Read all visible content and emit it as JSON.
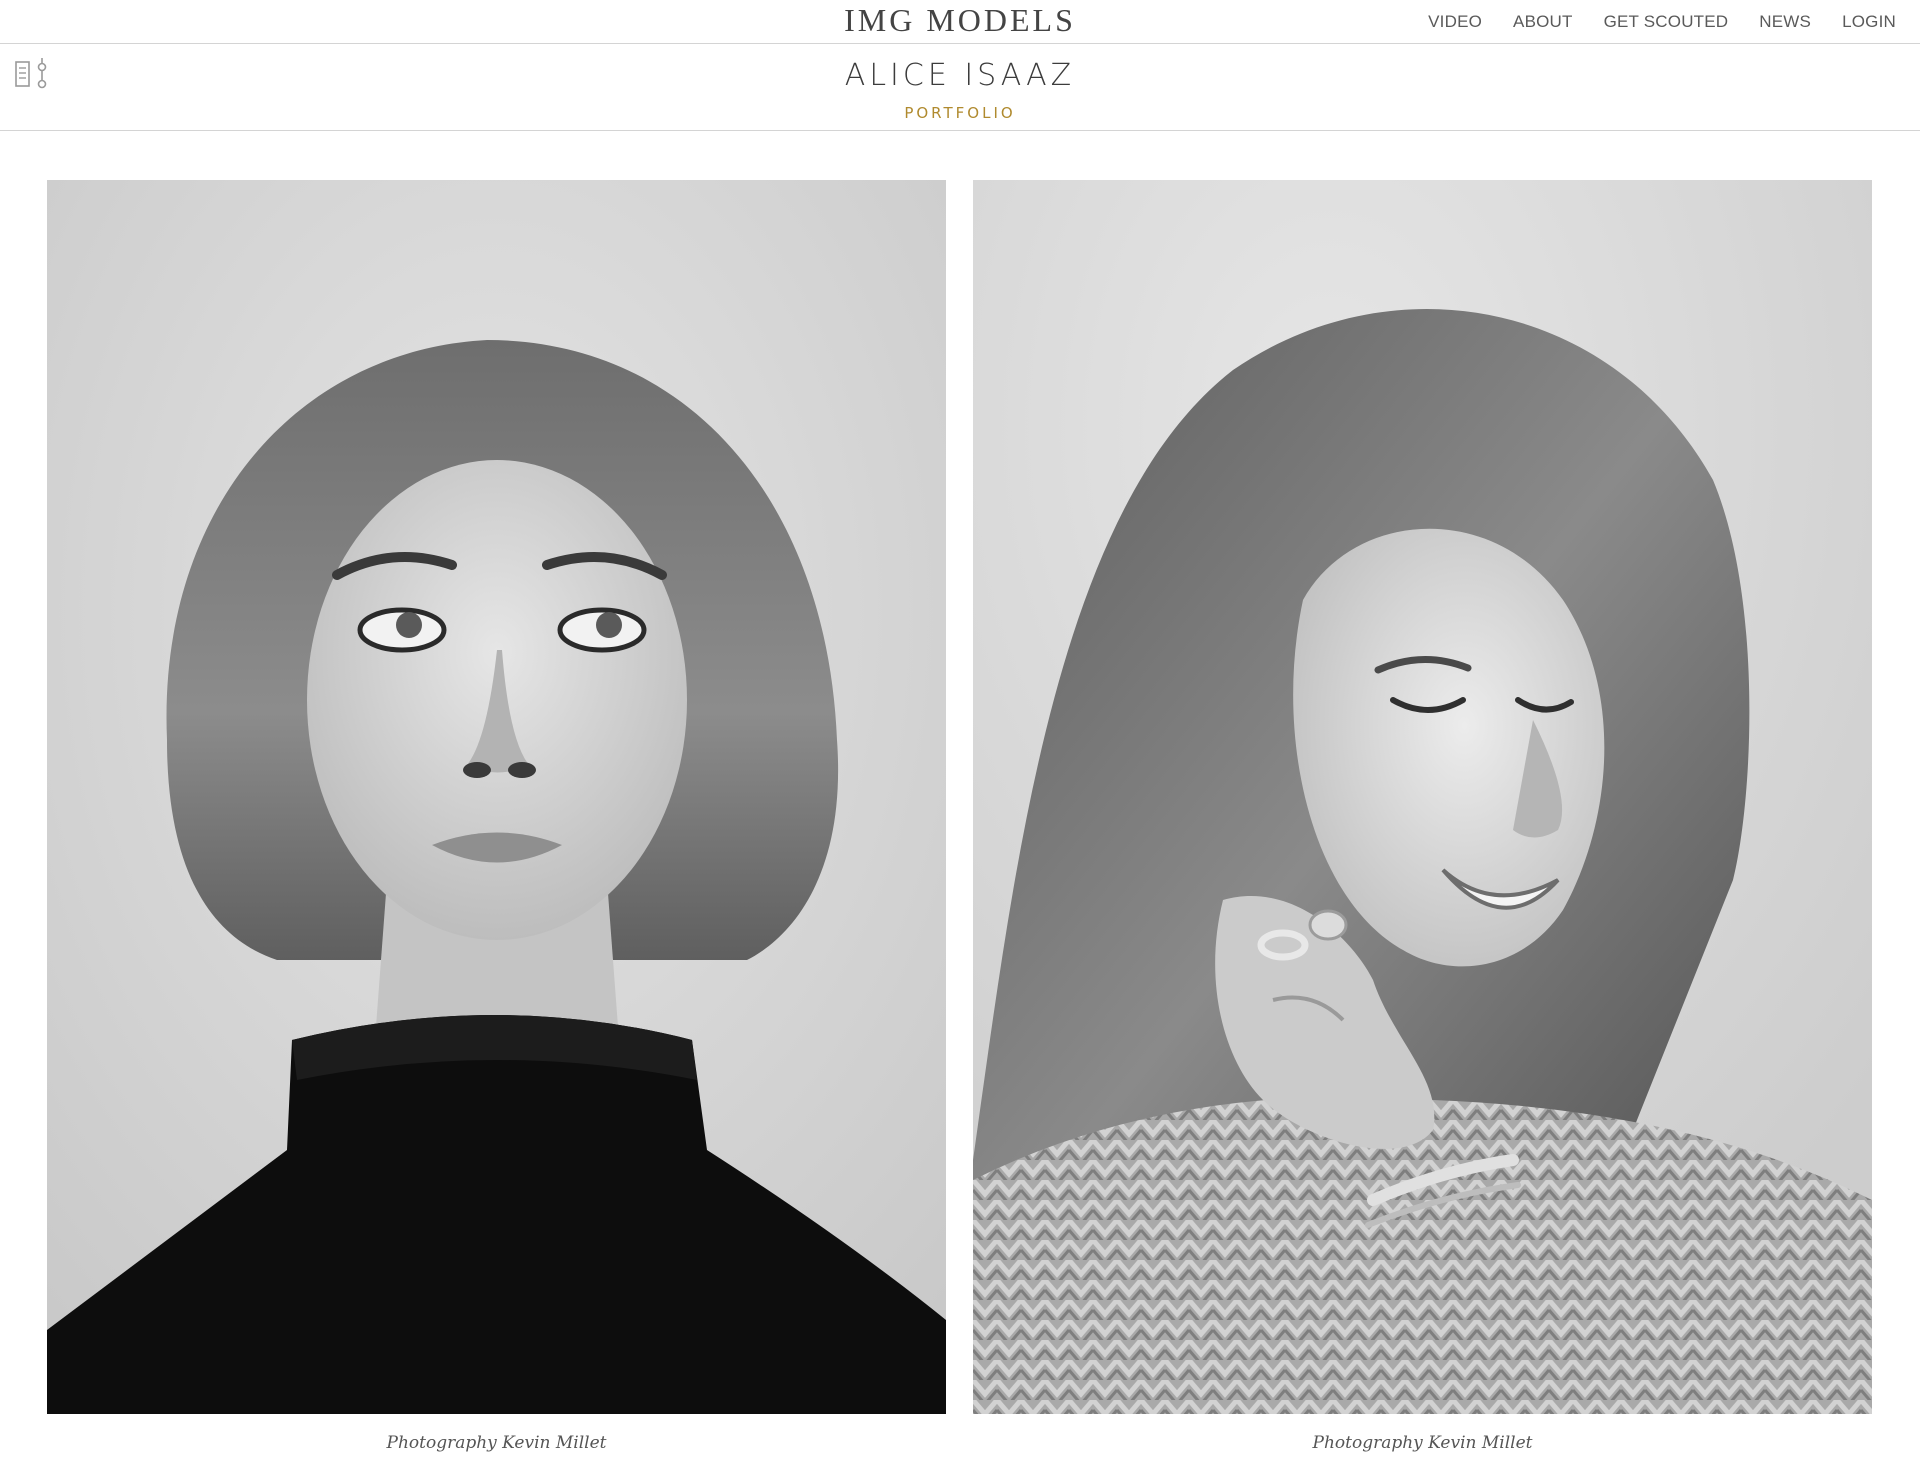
{
  "brand": {
    "name": "IMG MODELS"
  },
  "nav": {
    "items": [
      {
        "label": "VIDEO"
      },
      {
        "label": "ABOUT"
      },
      {
        "label": "GET SCOUTED"
      },
      {
        "label": "NEWS"
      },
      {
        "label": "LOGIN"
      }
    ]
  },
  "model": {
    "name": "ALICE ISAAZ",
    "section": "PORTFOLIO"
  },
  "icons": {
    "menu_toggle": "sliders-menu-icon"
  },
  "gallery": {
    "photos": [
      {
        "caption": "Photography Kevin Millet"
      },
      {
        "caption": "Photography Kevin Millet"
      }
    ]
  },
  "colors": {
    "accent_gold": "#b08a2e",
    "divider": "#d4d4d4"
  }
}
